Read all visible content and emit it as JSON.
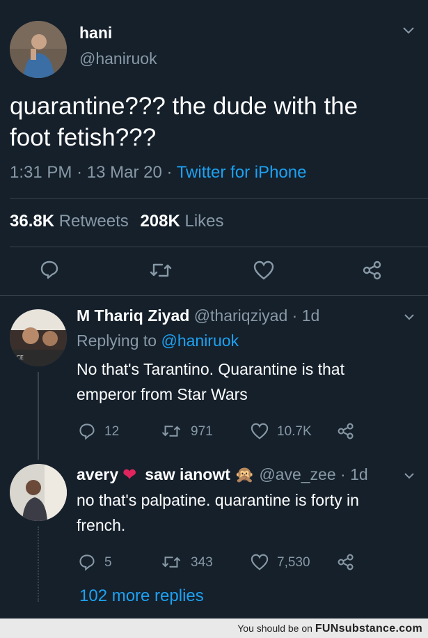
{
  "tweet": {
    "name": "hani",
    "handle": "@haniruok",
    "text_line1": "quarantine??? the dude with the",
    "text_line2": "foot fetish???",
    "time": "1:31 PM",
    "dot1": "·",
    "date": "13 Mar 20",
    "dot2": "·",
    "source": "Twitter for iPhone",
    "retweets_count": "36.8K",
    "retweets_label": "Retweets",
    "likes_count": "208K",
    "likes_label": "Likes"
  },
  "replies": [
    {
      "name": "M Thariq Ziyad",
      "handle": "@thariqziyad",
      "time": "· 1d",
      "replying_prefix": "Replying to",
      "replying_handle": "@haniruok",
      "text_line1": "No that's Tarantino. Quarantine is that",
      "text_line2": "emperor from Star Wars",
      "reply_count": "12",
      "retweet_count": "971",
      "like_count": "10.7K"
    },
    {
      "name_part1": "avery",
      "heart_emoji": "❤",
      "name_part2": "saw ianowt",
      "monkey_emoji": "🙊",
      "handle": "@ave_zee",
      "time": "· 1d",
      "text_line1": "no that's palpatine. quarantine is forty in",
      "text_line2": "french.",
      "reply_count": "5",
      "retweet_count": "343",
      "like_count": "7,530"
    }
  ],
  "more_replies": "102 more replies",
  "footer": {
    "prefix": "You should be on",
    "brand": "FUNsubstance.com"
  },
  "colors": {
    "background": "#15202b",
    "accent": "#1da1f2",
    "muted": "#8899a6",
    "heart": "#e0245e"
  }
}
